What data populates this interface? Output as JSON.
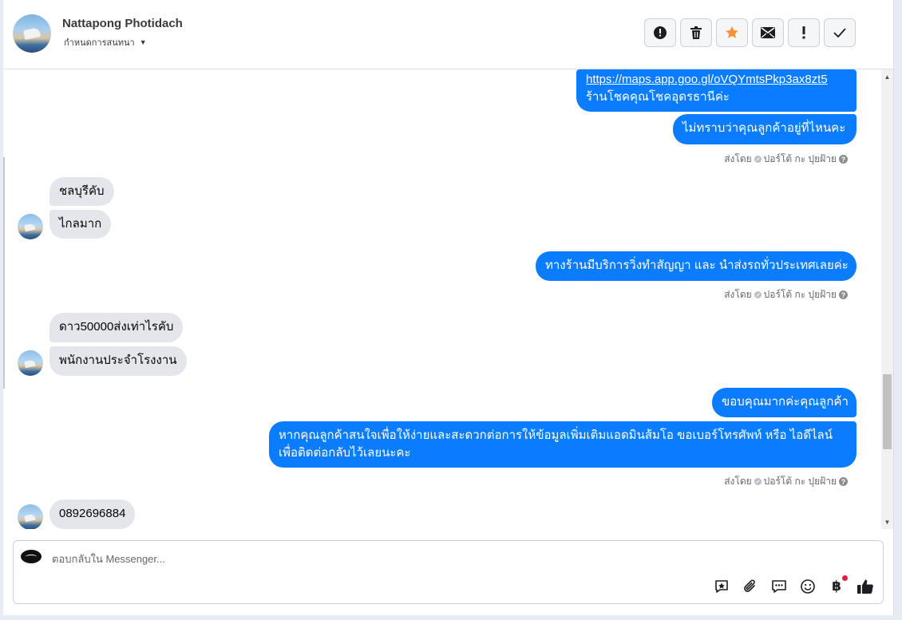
{
  "header": {
    "contact_name": "Nattapong Photidach",
    "subtitle": "กำหนดการสนทนา",
    "actions": [
      "spam-alert",
      "delete",
      "star",
      "mail",
      "important",
      "done"
    ]
  },
  "messages": {
    "m1_link": "https://maps.app.goo.gl/oVQYmtsPkp3ax8zt5",
    "m1_text": "ร้านโชคคุณโชคอุดรธานีค่ะ",
    "m2_text": "ไม่ทราบว่าคุณลูกค้าอยู่ที่ไหนคะ",
    "sent_by_label": "ส่งโดย",
    "sent_by_name": "ปอร์โต้ กะ ปุยฝ้าย",
    "in1": "ชลบุรีคับ",
    "in2": "ไกลมาก",
    "m3_text": "ทางร้านมีบริการวิ่งทำสัญญา และ นำส่งรถทั่วประเทศเลยค่ะ",
    "in3": "ดาว50000ส่งเท่าไรคับ",
    "in4": "พนักงานประจำโรงงาน",
    "m4_text": "ขอบคุณมากค่ะคุณลูกค้า",
    "m5_line1": "หากคุณลูกค้าสนใจเพื่อให้ง่ายและสะดวกต่อการให้ข้อมูลเพิ่มเติมแอดมินส้มโอ ขอเบอร์โทรศัพท์ หรือ ไอดีไลน์",
    "m5_line2": "เพื่อติดต่อกลับไว้เลยนะคะ",
    "in5": "0892696884"
  },
  "composer": {
    "placeholder": "ตอบกลับใน Messenger...",
    "currency_symbol": "฿"
  },
  "colors": {
    "outgoing": "#0a7cff",
    "incoming": "#e4e6eb",
    "star": "#f7923a"
  }
}
